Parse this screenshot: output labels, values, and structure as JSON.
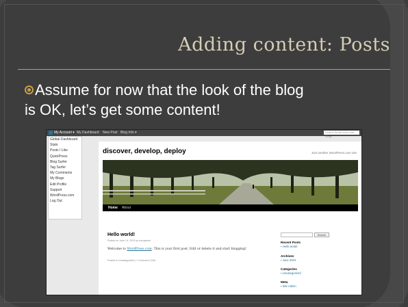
{
  "slide": {
    "title": "Adding content: Posts",
    "bullet_line1": "Assume for now that the look of the blog",
    "bullet_line2": "is OK, let’s get some content!",
    "accent": "#c8a046"
  },
  "screenshot": {
    "admin_bar": {
      "items": [
        "My Account ▾",
        "My Dashboard",
        "New Post",
        "Blog Info ▾"
      ],
      "search_placeholder": "Search WordPress.com Blogs"
    },
    "account_menu": [
      "Global Dashboard",
      "Stats",
      "Posts I Like",
      "QuickPress",
      "Blog Surfer",
      "Tag Surfer",
      "My Comments",
      "My Blogs",
      "Edit Profile",
      "Support",
      "WordPress.com",
      "Log Out"
    ],
    "blog": {
      "title": "discover, develop, deploy",
      "tagline": "Just another WordPress.com site",
      "nav": [
        "Home",
        "About"
      ]
    },
    "post": {
      "title": "Hello world!",
      "meta": "Posted on June 14, 2010 by cocoapoint",
      "body_prefix": "Welcome to ",
      "body_link": "WordPress.com",
      "body_suffix": ". This is your first post. Edit or delete it and start blogging!",
      "footer": "Posted in Uncategorized | 1 Comment | Edit"
    },
    "sidebar": {
      "search_button": "Search",
      "recent_posts_title": "Recent Posts",
      "recent_posts": [
        "Hello world!"
      ],
      "archives_title": "Archives",
      "archives": [
        "June 2010"
      ],
      "categories_title": "Categories",
      "categories": [
        "Uncategorized"
      ],
      "meta_title": "Meta",
      "meta": [
        "Site Admin"
      ]
    }
  }
}
